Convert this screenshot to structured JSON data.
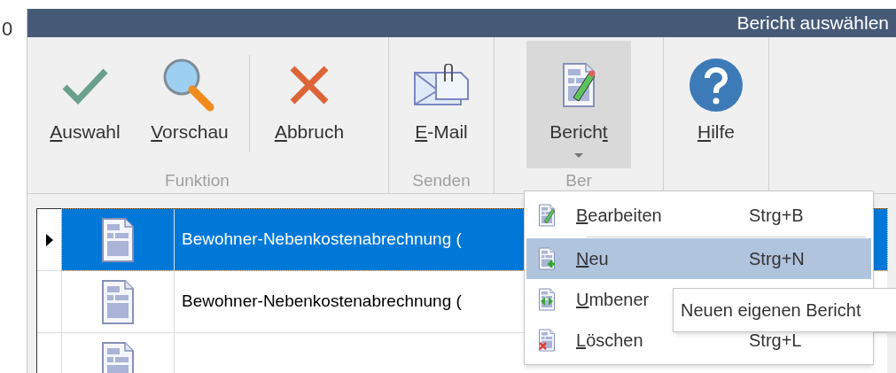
{
  "background_fragment": "0",
  "window": {
    "title": "Bericht auswählen"
  },
  "ribbon": {
    "groups": [
      {
        "label": "Funktion",
        "buttons": [
          {
            "kind": "check",
            "label": {
              "key": "A",
              "after": "uswahl"
            },
            "pressed": false
          },
          {
            "kind": "magnifier",
            "label": {
              "key": "V",
              "after": "orschau"
            },
            "pressed": false
          },
          {
            "kind": "divider"
          },
          {
            "kind": "cross",
            "label": {
              "key": "A",
              "after": "bbruch"
            },
            "pressed": false
          }
        ]
      },
      {
        "label": "Senden",
        "buttons": [
          {
            "kind": "mail",
            "label": {
              "key": "E",
              "after": "-Mail"
            },
            "pressed": false
          }
        ]
      },
      {
        "label": "Ber",
        "buttons": [
          {
            "kind": "report",
            "label": {
              "before": "Berich",
              "key": "t"
            },
            "pressed": true,
            "dropdown": true
          }
        ]
      },
      {
        "buttons": [
          {
            "kind": "help",
            "label": {
              "key": "H",
              "after": "ilfe"
            },
            "pressed": false
          }
        ]
      }
    ]
  },
  "table": {
    "rows": [
      {
        "current": true,
        "selected": true,
        "name": "Bewohner-Nebenkostenabrechnung ("
      },
      {
        "current": false,
        "selected": false,
        "name": "Bewohner-Nebenkostenabrechnung ("
      },
      {
        "current": false,
        "selected": false
      }
    ]
  },
  "menu": {
    "items": [
      {
        "kind": "edit",
        "label": {
          "key": "B",
          "after": "earbeiten"
        },
        "shortcut": "Strg+B",
        "selected": false,
        "separator_after": true
      },
      {
        "kind": "new",
        "label": {
          "key": "N",
          "after": "eu"
        },
        "shortcut": "Strg+N",
        "selected": true,
        "separator_after": false
      },
      {
        "kind": "rename",
        "label": {
          "key": "U",
          "after": "mbener"
        },
        "selected": false,
        "separator_after": false
      },
      {
        "kind": "delete",
        "label": {
          "key": "L",
          "after": "öschen"
        },
        "shortcut": "Strg+L",
        "selected": false,
        "separator_after": false
      }
    ]
  },
  "tooltip": {
    "text": "Neuen eigenen Bericht"
  }
}
